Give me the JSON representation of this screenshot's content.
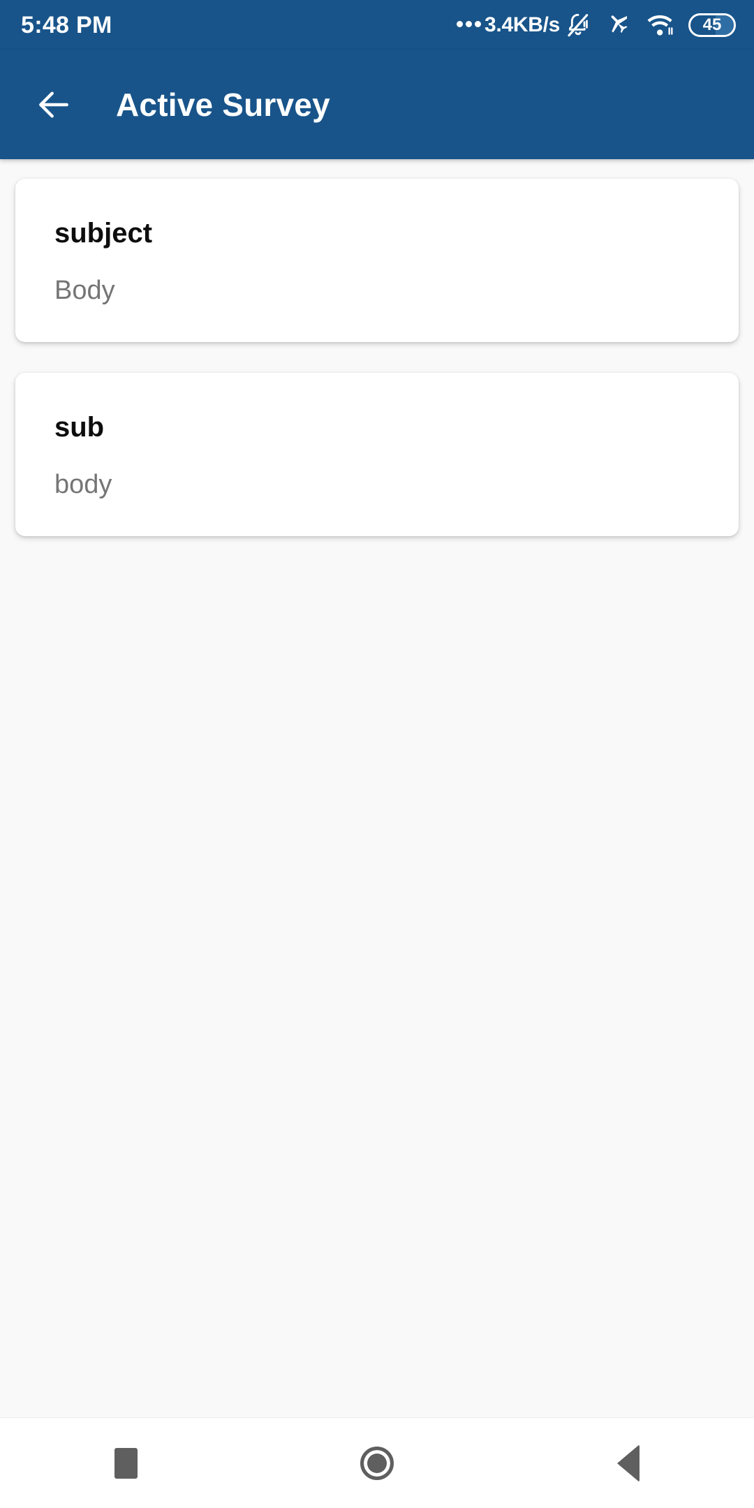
{
  "status_bar": {
    "clock": "5:48 PM",
    "network_speed": "3.4KB/s",
    "battery_level": "45",
    "icons": [
      "network-dots-icon",
      "mute-bell-icon",
      "airplane-mode-icon",
      "wifi-icon",
      "battery-icon"
    ]
  },
  "app_bar": {
    "back_label": "back-arrow-icon",
    "title": "Active Survey",
    "background_color": "#18548a",
    "text_color": "#ffffff"
  },
  "main": {
    "background_color": "#f9f9f9",
    "cards": [
      {
        "title": "subject",
        "body": "Body"
      },
      {
        "title": "sub",
        "body": "body"
      }
    ]
  },
  "nav_bar": {
    "recents_label": "recents-button",
    "home_label": "home-button",
    "back_label": "back-button",
    "icon_color": "#5f5f5f"
  }
}
